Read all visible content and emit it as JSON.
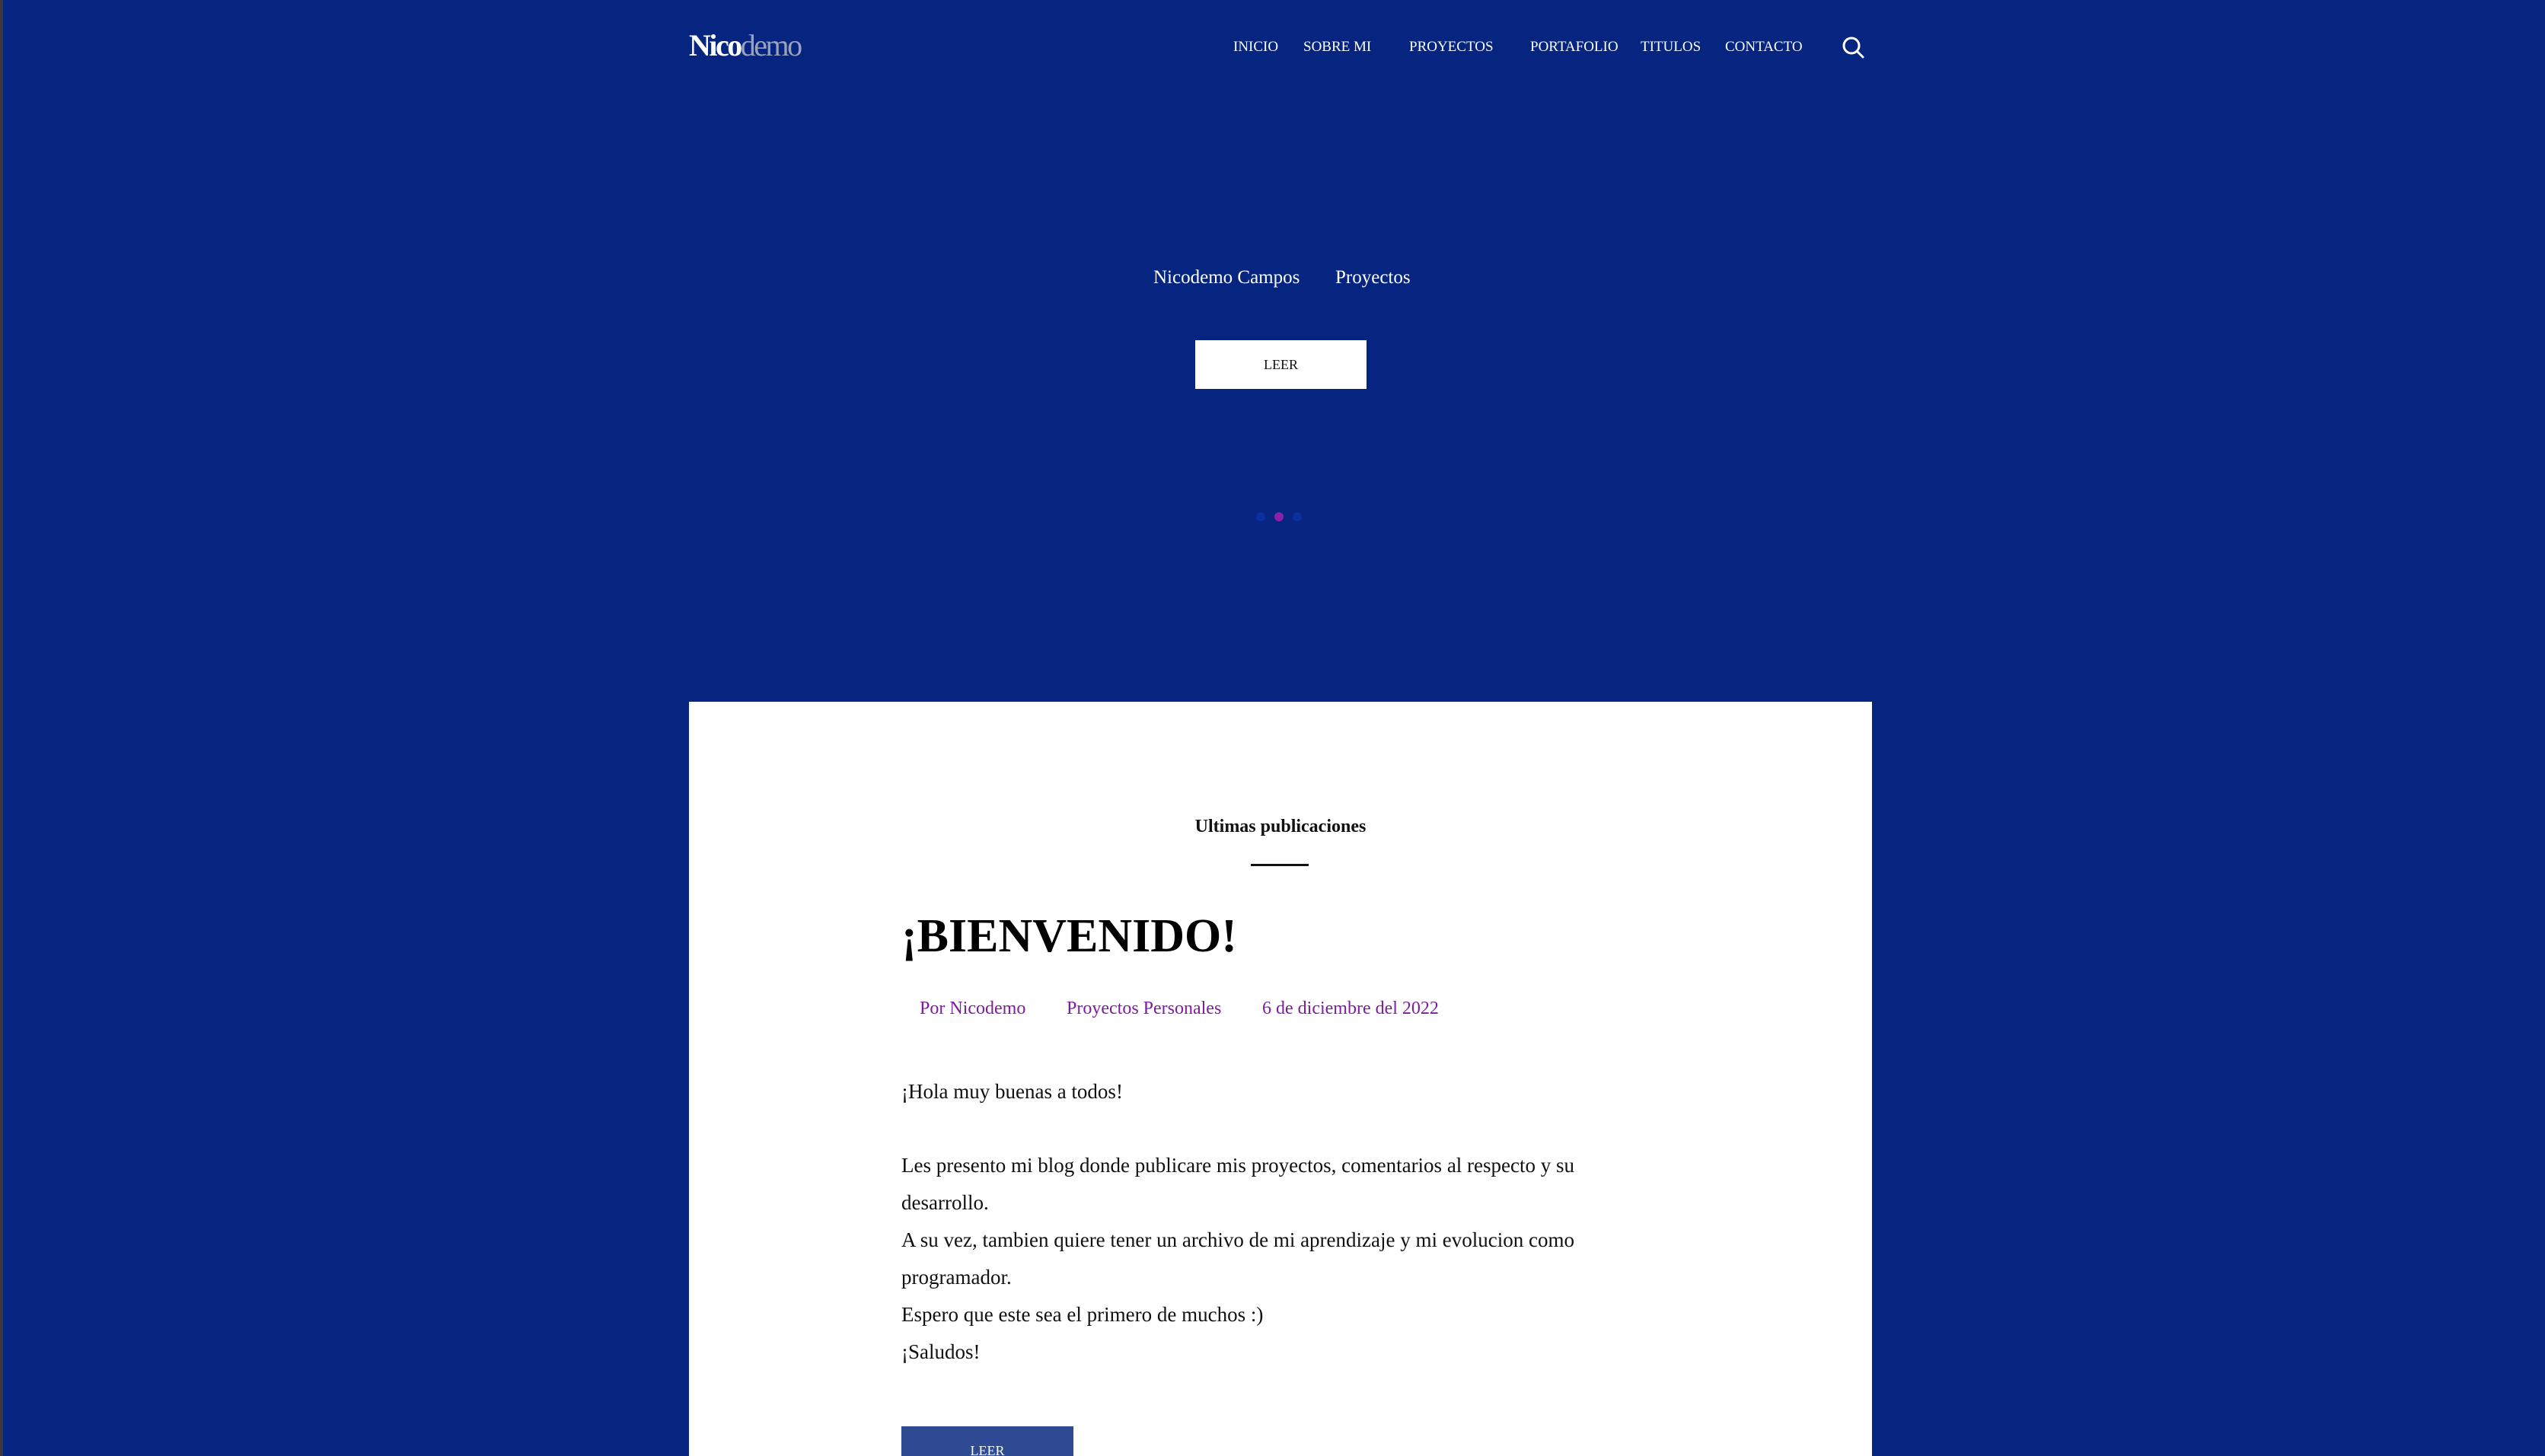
{
  "logo": {
    "bold": "Nico",
    "light": "demo"
  },
  "nav": {
    "items": [
      {
        "label": "INICIO"
      },
      {
        "label": "SOBRE MI"
      },
      {
        "label": "PROYECTOS"
      },
      {
        "label": "PORTAFOLIO"
      },
      {
        "label": "TITULOS"
      },
      {
        "label": "CONTACTO"
      }
    ],
    "search_icon": "search-icon"
  },
  "hero": {
    "links": [
      "Nicodemo Campos",
      "Proyectos"
    ],
    "button_label": "LEER",
    "slider": {
      "dot_count": 3,
      "active_index": 1
    }
  },
  "main": {
    "section_title": "Ultimas publicaciones",
    "post": {
      "title": "¡BIENVENIDO!",
      "author": "Por Nicodemo",
      "category": "Proyectos Personales",
      "date": "6 de diciembre del 2022",
      "paragraphs": [
        "¡Hola muy buenas a todos!",
        "Les presento mi blog donde publicare mis proyectos, comentarios al respecto y su desarrollo.",
        "A su vez, tambien quiere tener un archivo de mi aprendizaje y mi evolucion como programador.",
        "Espero que este sea el primero de muchos :)",
        "¡Saludos!"
      ],
      "button_label": "LEER"
    }
  },
  "colors": {
    "background": "#052581",
    "card": "#ffffff",
    "accent_purple": "#7e1b9e",
    "button_blue": "#2f4b93",
    "active_dot": "#8a1fa8"
  }
}
